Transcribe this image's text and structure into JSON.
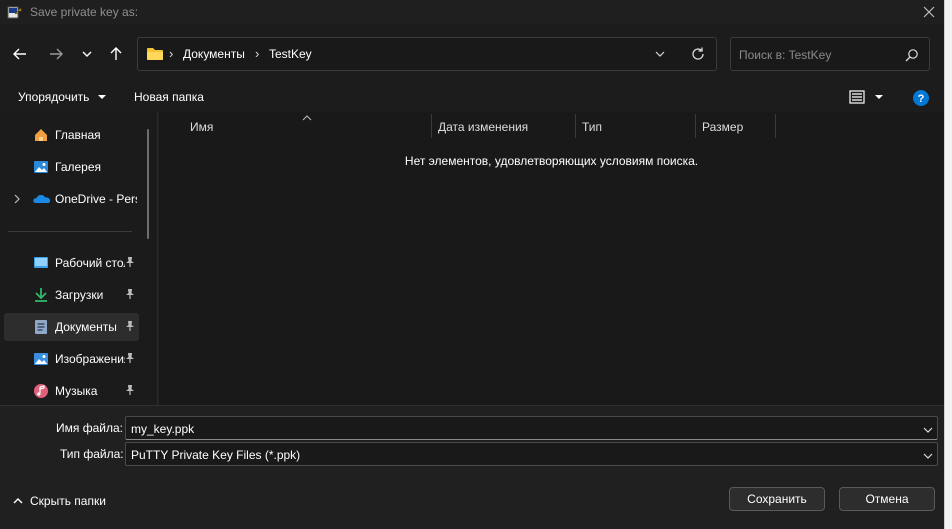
{
  "window": {
    "title": "Save private key as:"
  },
  "address": {
    "crumbs": [
      "Документы",
      "TestKey"
    ]
  },
  "search": {
    "placeholder": "Поиск в: TestKey"
  },
  "toolbar": {
    "organize_label": "Упорядочить",
    "new_folder_label": "Новая папка"
  },
  "sidebar": {
    "items": [
      {
        "label": "Главная",
        "icon": "home-icon"
      },
      {
        "label": "Галерея",
        "icon": "gallery-icon"
      },
      {
        "label": "OneDrive - Perso",
        "icon": "onedrive-icon"
      },
      {
        "label": "Рабочий стол",
        "icon": "desktop-icon",
        "pinned": true
      },
      {
        "label": "Загрузки",
        "icon": "downloads-icon",
        "pinned": true
      },
      {
        "label": "Документы",
        "icon": "documents-icon",
        "pinned": true,
        "selected": true
      },
      {
        "label": "Изображения",
        "icon": "pictures-icon",
        "pinned": true
      },
      {
        "label": "Музыка",
        "icon": "music-icon",
        "pinned": true
      }
    ]
  },
  "columns": {
    "name": "Имя",
    "date": "Дата изменения",
    "type": "Тип",
    "size": "Размер"
  },
  "content": {
    "empty_message": "Нет элементов, удовлетворяющих условиям поиска."
  },
  "form": {
    "filename_label": "Имя файла:",
    "filename_value": "my_key.ppk",
    "filetype_label": "Тип файла:",
    "filetype_value": "PuTTY Private Key Files (*.ppk)",
    "hide_folders_label": "Скрыть папки",
    "save_label": "Сохранить",
    "cancel_label": "Отмена"
  },
  "colors": {
    "background": "#202020",
    "accent": "#0078d4",
    "folder": "#f4c430"
  }
}
